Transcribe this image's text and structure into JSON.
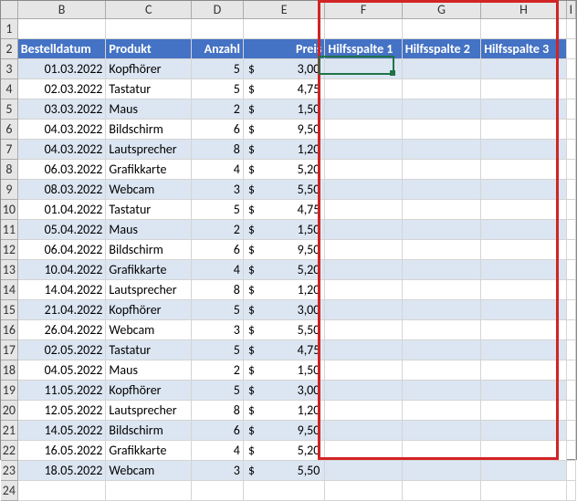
{
  "colHeaders": [
    "A",
    "B",
    "C",
    "D",
    "E",
    "F",
    "G",
    "H",
    "I"
  ],
  "rowCount": 24,
  "activeCell": {
    "row": 3,
    "col": "F"
  },
  "highlightCols": [
    "F",
    "G",
    "H"
  ],
  "tableHeaders": {
    "B": "Bestelldatum",
    "C": "Produkt",
    "D": "Anzahl",
    "E": "Preis",
    "F": "Hilfsspalte 1",
    "G": "Hilfsspalte 2",
    "H": "Hilfsspalte 3"
  },
  "currencySymbol": "$",
  "rows": [
    {
      "date": "01.03.2022",
      "product": "Kopfhörer",
      "qty": 5,
      "price": "3,00"
    },
    {
      "date": "02.03.2022",
      "product": "Tastatur",
      "qty": 5,
      "price": "4,75"
    },
    {
      "date": "03.03.2022",
      "product": "Maus",
      "qty": 2,
      "price": "1,50"
    },
    {
      "date": "04.03.2022",
      "product": "Bildschirm",
      "qty": 6,
      "price": "9,50"
    },
    {
      "date": "04.03.2022",
      "product": "Lautsprecher",
      "qty": 8,
      "price": "1,20"
    },
    {
      "date": "06.03.2022",
      "product": "Grafikkarte",
      "qty": 4,
      "price": "5,20"
    },
    {
      "date": "08.03.2022",
      "product": "Webcam",
      "qty": 3,
      "price": "5,50"
    },
    {
      "date": "01.04.2022",
      "product": "Tastatur",
      "qty": 5,
      "price": "4,75"
    },
    {
      "date": "05.04.2022",
      "product": "Maus",
      "qty": 2,
      "price": "1,50"
    },
    {
      "date": "06.04.2022",
      "product": "Bildschirm",
      "qty": 6,
      "price": "9,50"
    },
    {
      "date": "10.04.2022",
      "product": "Grafikkarte",
      "qty": 4,
      "price": "5,20"
    },
    {
      "date": "14.04.2022",
      "product": "Lautsprecher",
      "qty": 8,
      "price": "1,20"
    },
    {
      "date": "21.04.2022",
      "product": "Kopfhörer",
      "qty": 5,
      "price": "3,00"
    },
    {
      "date": "26.04.2022",
      "product": "Webcam",
      "qty": 3,
      "price": "5,50"
    },
    {
      "date": "02.05.2022",
      "product": "Tastatur",
      "qty": 5,
      "price": "4,75"
    },
    {
      "date": "04.05.2022",
      "product": "Maus",
      "qty": 2,
      "price": "1,50"
    },
    {
      "date": "11.05.2022",
      "product": "Kopfhörer",
      "qty": 5,
      "price": "3,00"
    },
    {
      "date": "12.05.2022",
      "product": "Lautsprecher",
      "qty": 8,
      "price": "1,20"
    },
    {
      "date": "14.05.2022",
      "product": "Bildschirm",
      "qty": 6,
      "price": "9,50"
    },
    {
      "date": "16.05.2022",
      "product": "Grafikkarte",
      "qty": 4,
      "price": "5,20"
    },
    {
      "date": "18.05.2022",
      "product": "Webcam",
      "qty": 3,
      "price": "5,50"
    }
  ]
}
